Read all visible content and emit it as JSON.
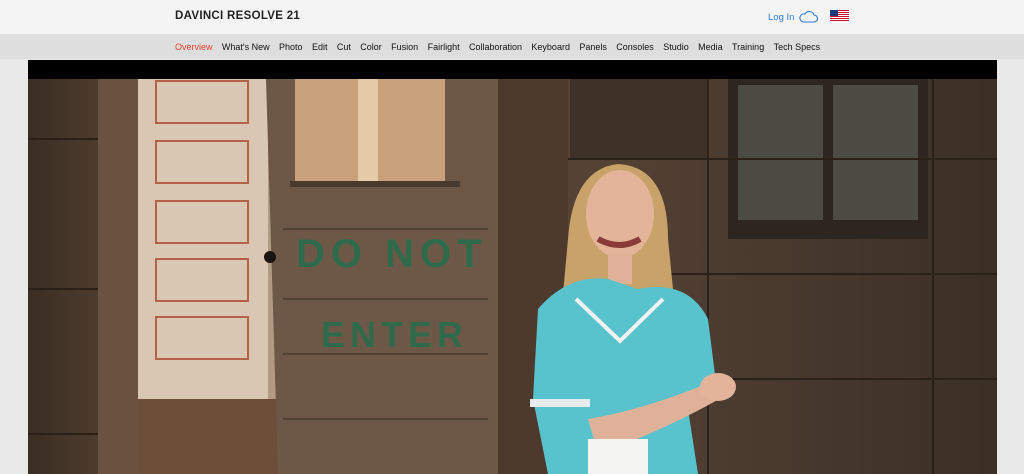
{
  "header": {
    "brand": "DAVINCI RESOLVE 21",
    "login_label": "Log In",
    "login_icon": "cloud-icon",
    "locale_icon": "us-flag-icon"
  },
  "nav": {
    "items": [
      {
        "label": "Overview",
        "active": true
      },
      {
        "label": "What's New",
        "active": false
      },
      {
        "label": "Photo",
        "active": false
      },
      {
        "label": "Edit",
        "active": false
      },
      {
        "label": "Cut",
        "active": false
      },
      {
        "label": "Color",
        "active": false
      },
      {
        "label": "Fusion",
        "active": false
      },
      {
        "label": "Fairlight",
        "active": false
      },
      {
        "label": "Collaboration",
        "active": false
      },
      {
        "label": "Keyboard",
        "active": false
      },
      {
        "label": "Panels",
        "active": false
      },
      {
        "label": "Consoles",
        "active": false
      },
      {
        "label": "Studio",
        "active": false
      },
      {
        "label": "Media",
        "active": false
      },
      {
        "label": "Training",
        "active": false
      },
      {
        "label": "Tech Specs",
        "active": false
      }
    ],
    "active_color": "#e2452b"
  },
  "hero": {
    "door_sign_line1": "DO NOT",
    "door_sign_line2": "ENTER"
  }
}
